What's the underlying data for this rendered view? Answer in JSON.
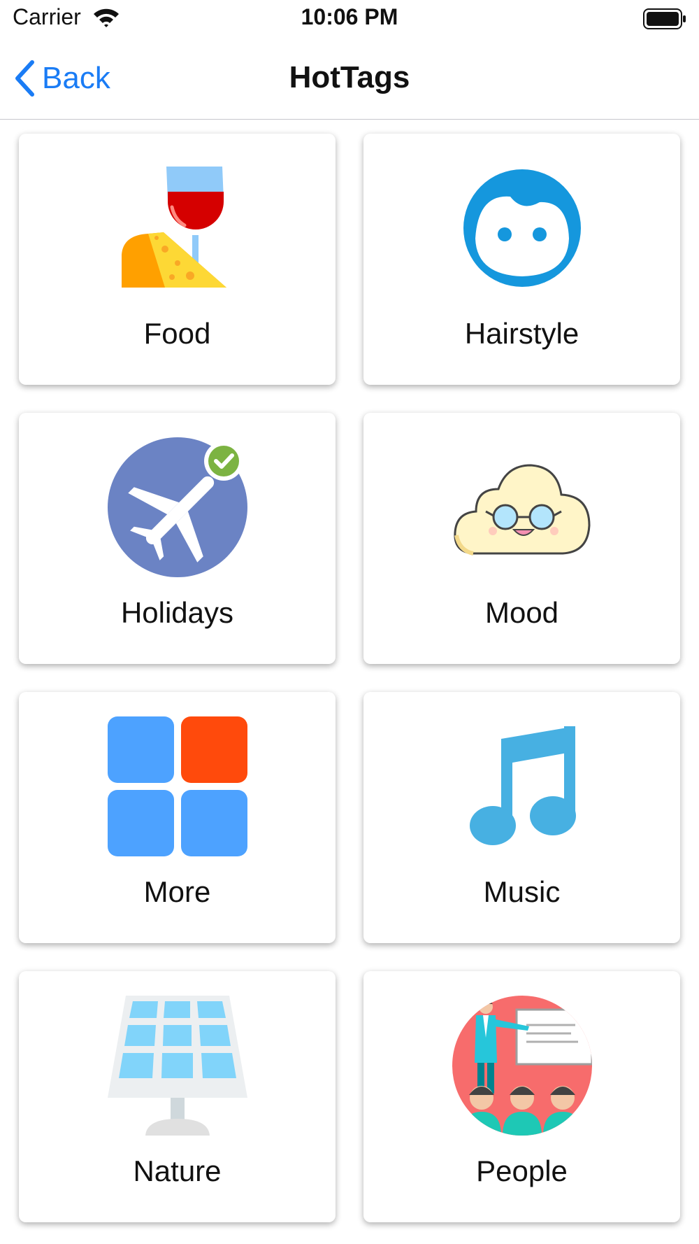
{
  "status_bar": {
    "carrier": "Carrier",
    "time": "10:06 PM"
  },
  "nav": {
    "back_label": "Back",
    "title": "HotTags"
  },
  "accent_color": "#1a7cf5",
  "tags": [
    {
      "label": "Food",
      "icon": "wine-cheese-icon"
    },
    {
      "label": "Hairstyle",
      "icon": "face-icon"
    },
    {
      "label": "Holidays",
      "icon": "airplane-icon"
    },
    {
      "label": "Mood",
      "icon": "cloud-with-glasses-icon"
    },
    {
      "label": "More",
      "icon": "grid-squares-icon"
    },
    {
      "label": "Music",
      "icon": "music-note-icon"
    },
    {
      "label": "Nature",
      "icon": "solar-panel-icon"
    },
    {
      "label": "People",
      "icon": "presentation-audience-icon"
    }
  ]
}
